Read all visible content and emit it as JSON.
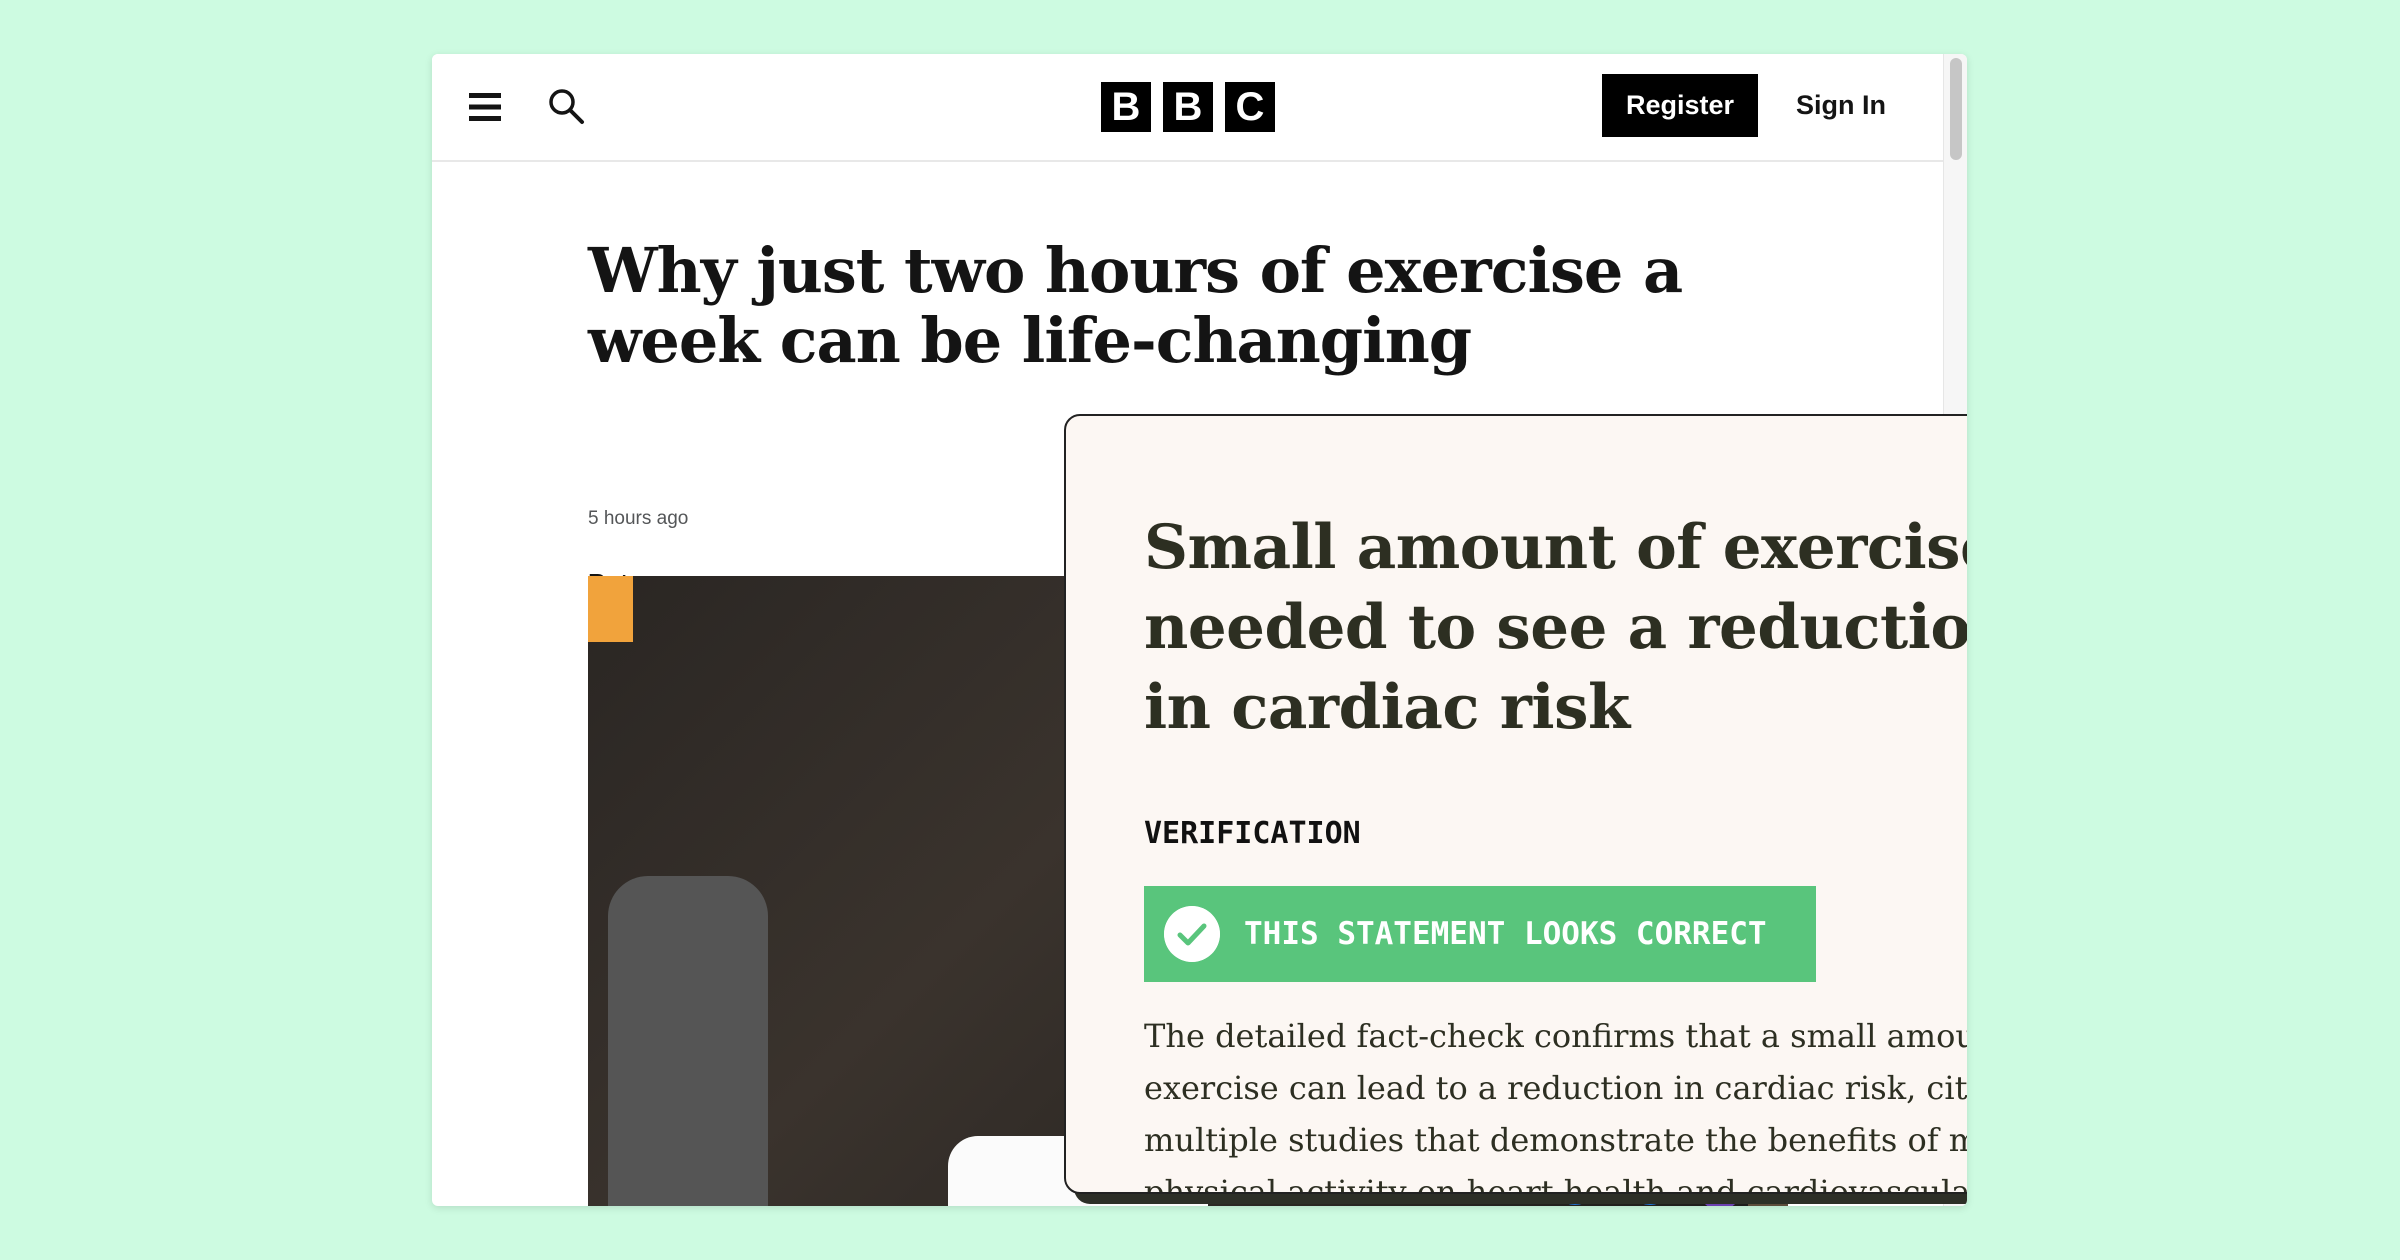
{
  "header": {
    "logo_letters": [
      "B",
      "B",
      "C"
    ],
    "register_label": "Register",
    "signin_label": "Sign In"
  },
  "article": {
    "title": "Why just two hours of exercise a week can be life-changing",
    "meta": "5 hours ago",
    "byline": "Peter",
    "share_glyph": "+"
  },
  "popup": {
    "title": "Small amount of exercise is needed to see a reduction in cardiac risk",
    "verification_label": "VERIFICATION",
    "verdict": "THIS STATEMENT LOOKS CORRECT",
    "verdict_color": "#59c57c",
    "body": "The detailed fact-check confirms that a small amount of exercise can lead to a reduction in cardiac risk, citing multiple studies that demonstrate the benefits of minimal physical activity on heart health and cardiovascular disease risk factors."
  },
  "icons": {
    "menu": "menu-icon",
    "search": "search-icon",
    "close": "close-icon",
    "check": "check-icon"
  }
}
